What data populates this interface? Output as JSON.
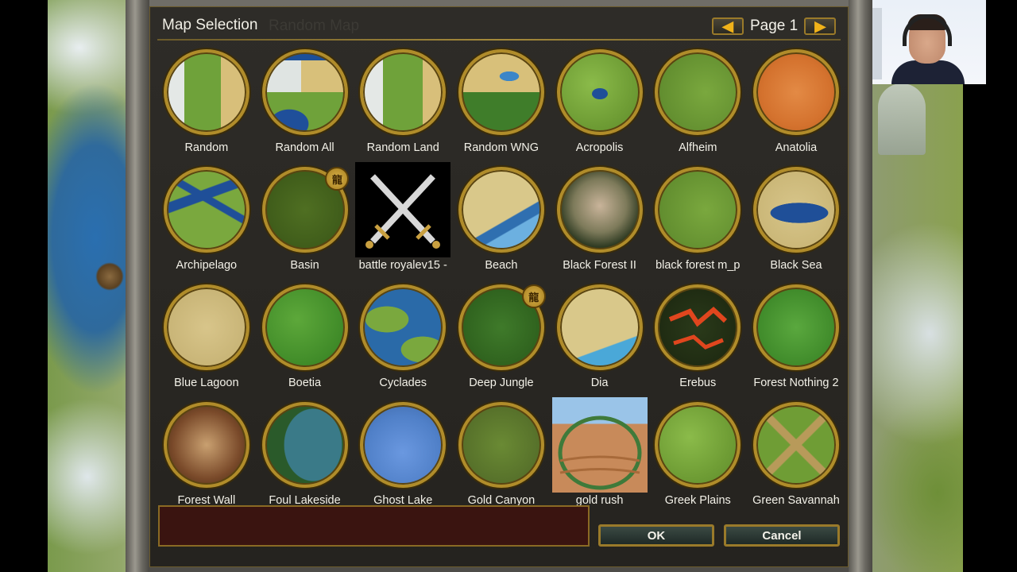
{
  "dialog": {
    "title": "Map Selection",
    "background_title": "Random Map",
    "page_label": "Page 1",
    "prev_arrow": "◀",
    "next_arrow": "▶",
    "ok_label": "OK",
    "cancel_label": "Cancel",
    "description": ""
  },
  "maps": [
    {
      "label": "Random"
    },
    {
      "label": "Random All"
    },
    {
      "label": "Random Land"
    },
    {
      "label": "Random WNG"
    },
    {
      "label": "Acropolis"
    },
    {
      "label": "Alfheim"
    },
    {
      "label": "Anatolia"
    },
    {
      "label": "Archipelago"
    },
    {
      "label": "Basin",
      "badge": "龍"
    },
    {
      "label": "battle royalev15 -"
    },
    {
      "label": "Beach"
    },
    {
      "label": "Black Forest II"
    },
    {
      "label": "black forest m_p"
    },
    {
      "label": "Black Sea"
    },
    {
      "label": "Blue Lagoon"
    },
    {
      "label": "Boetia"
    },
    {
      "label": "Cyclades"
    },
    {
      "label": "Deep Jungle",
      "badge": "龍"
    },
    {
      "label": "Dia"
    },
    {
      "label": "Erebus"
    },
    {
      "label": "Forest Nothing 2"
    },
    {
      "label": "Forest Wall"
    },
    {
      "label": "Foul Lakeside"
    },
    {
      "label": "Ghost Lake"
    },
    {
      "label": "Gold Canyon"
    },
    {
      "label": "gold rush"
    },
    {
      "label": "Greek Plains"
    },
    {
      "label": "Green Savannah"
    }
  ],
  "colors": {
    "accent_gold": "#b08c2a",
    "panel": "#25231f",
    "text": "#f3f1e8",
    "arrow": "#f0b21a"
  }
}
